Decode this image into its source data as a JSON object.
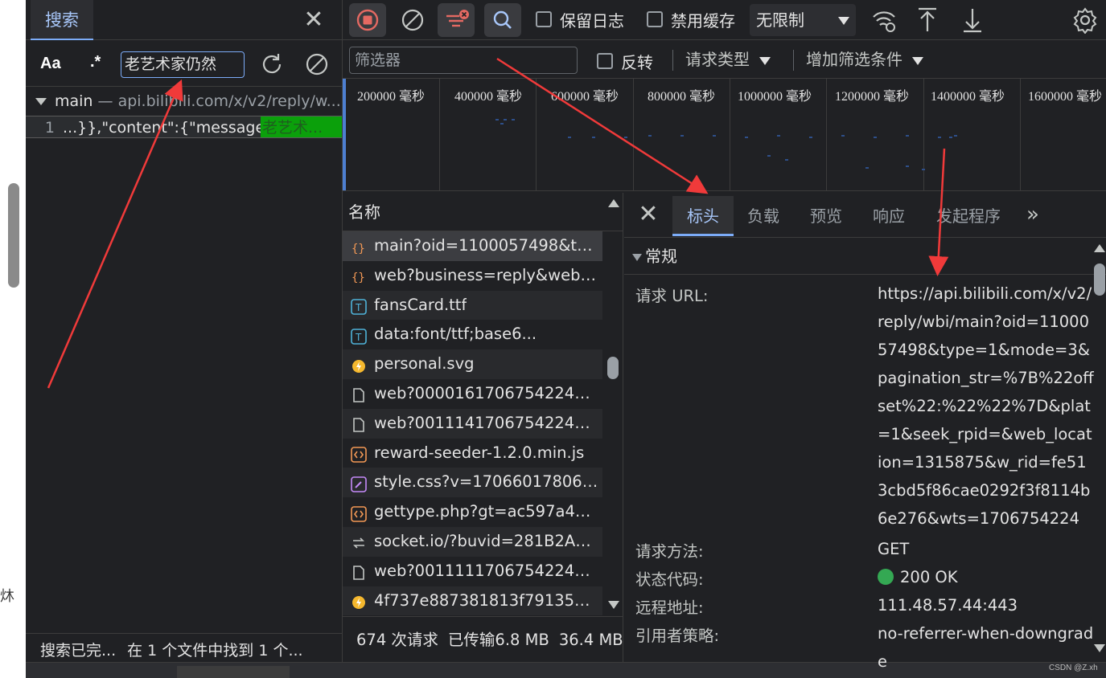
{
  "colors": {
    "accent": "#7cacf8",
    "record_red": "#e46962",
    "match_highlight": "#0ba00b",
    "status_ok": "#34a853",
    "annotation_arrow": "#f03a3a"
  },
  "search_panel": {
    "tab_label": "搜索",
    "close_icon": "close-icon",
    "match_case_label": "Aa",
    "regex_label": ".*",
    "query": "老艺术家仍然",
    "refresh_icon": "refresh-icon",
    "clear_icon": "clear-icon",
    "result_file": {
      "name": "main",
      "url": " — api.bilibili.com/x/v2/reply/w..."
    },
    "match": {
      "line_number": "1",
      "text": "...}},\"content\":{\"message\":\"",
      "highlight": "老艺术..."
    },
    "status_done": "搜索已完...",
    "status_found": "在 1 个文件中找到 1 个..."
  },
  "toolbar": {
    "record_icon": "record-stop-icon",
    "clear_icon": "clear-icon",
    "filter_icon": "filter-icon",
    "search_icon": "search-icon",
    "preserve_log_label": "保留日志",
    "disable_cache_label": "禁用缓存",
    "throttle_value": "无限制",
    "wifi_icon": "network-conditions-icon",
    "import_icon": "upload-icon",
    "export_icon": "download-icon",
    "settings_icon": "gear-icon"
  },
  "filter_bar": {
    "placeholder": "筛选器",
    "invert_label": "反转",
    "request_type_label": "请求类型",
    "more_filters_label": "增加筛选条件"
  },
  "overview": {
    "ticks": [
      "200000 毫秒",
      "400000 毫秒",
      "600000 毫秒",
      "800000 毫秒",
      "1000000 毫秒",
      "1200000 毫秒",
      "1400000 毫秒",
      "1600000 毫秒"
    ]
  },
  "request_list": {
    "header": "名称",
    "rows": [
      {
        "name": "main?oid=1100057498&typ...",
        "icon": "json-icon"
      },
      {
        "name": "web?business=reply&web_l...",
        "icon": "json-icon"
      },
      {
        "name": "fansCard.ttf",
        "icon": "font-icon"
      },
      {
        "name": "data:font/ttf;base6...",
        "icon": "font-icon"
      },
      {
        "name": "personal.svg",
        "icon": "image-icon"
      },
      {
        "name": "web?000016170675422449...",
        "icon": "document-icon"
      },
      {
        "name": "web?001114170675422458...",
        "icon": "document-icon"
      },
      {
        "name": "reward-seeder-1.2.0.min.js",
        "icon": "script-icon"
      },
      {
        "name": "style.css?v=1706601780666",
        "icon": "stylesheet-icon"
      },
      {
        "name": "gettype.php?gt=ac597a450...",
        "icon": "script-icon"
      },
      {
        "name": "socket.io/?buvid=281B2A4B...",
        "icon": "websocket-icon"
      },
      {
        "name": "web?001111170675422474...",
        "icon": "document-icon"
      },
      {
        "name": "4f737e887381813f7913522c...",
        "icon": "image-icon"
      }
    ],
    "summary": {
      "requests": "674 次请求",
      "transferred": "已传输6.8 MB",
      "resources": "36.4 MB"
    }
  },
  "details": {
    "tabs": [
      "标头",
      "负载",
      "预览",
      "响应",
      "发起程序"
    ],
    "active_tab": "标头",
    "section": "常规",
    "general": {
      "url_label": "请求 URL:",
      "url_value": "https://api.bilibili.com/x/v2/reply/wbi/main?oid=1100057498&type=1&mode=3&pagination_str=%7B%22offset%22:%22%22%7D&plat=1&seek_rpid=&web_location=1315875&w_rid=fe513cbd5f86cae0292f3f8114b6e276&wts=1706754224",
      "method_label": "请求方法:",
      "method_value": "GET",
      "status_label": "状态代码:",
      "status_value": "200 OK",
      "remote_label": "远程地址:",
      "remote_value": "111.48.57.44:443",
      "referrer_label": "引用者策略:",
      "referrer_value": "no-referrer-when-downgrade"
    }
  },
  "watermark": "CSDN @Z.xh",
  "page_glyph": "炑"
}
